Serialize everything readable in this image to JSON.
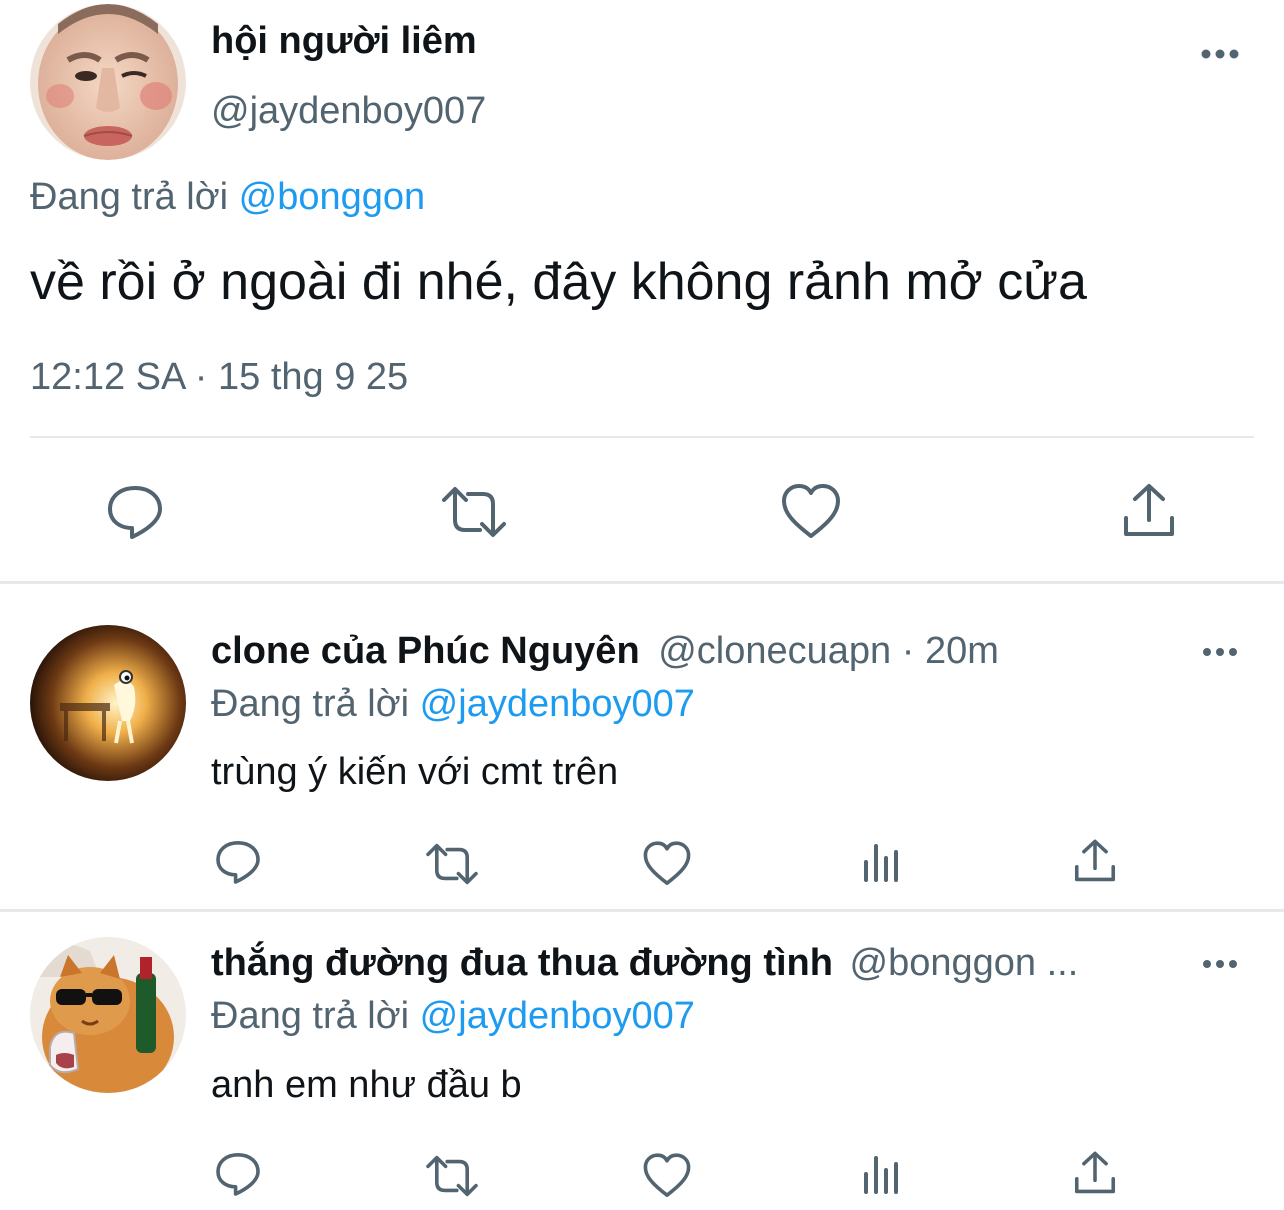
{
  "main_tweet": {
    "display_name": "hội người liêm",
    "handle": "@jaydenboy007",
    "replying_prefix": "Đang trả lời",
    "replying_to": "@bonggon",
    "text": "về rồi ở ngoài đi nhé, đây không rảnh mở cửa",
    "timestamp": "12:12 SA · 15 thg 9 25",
    "actions": [
      "reply-icon",
      "retweet-icon",
      "like-icon",
      "share-icon"
    ]
  },
  "replies": [
    {
      "display_name": "clone của Phúc Nguyên",
      "handle": "@clonecuapn",
      "time": "· 20m",
      "replying_prefix": "Đang trả lời",
      "replying_to": "@jaydenboy007",
      "text": "trùng ý kiến với cmt trên",
      "actions": [
        "reply-icon",
        "retweet-icon",
        "like-icon",
        "views-icon",
        "share-icon"
      ]
    },
    {
      "display_name": "thắng đường đua thua đường tình",
      "handle": "@bonggon ...",
      "replying_prefix": "Đang trả lời",
      "replying_to": "@jaydenboy007",
      "text": "anh em như đầu b",
      "actions": [
        "reply-icon",
        "retweet-icon",
        "like-icon",
        "views-icon",
        "share-icon"
      ]
    }
  ],
  "colors": {
    "text": "#0f1419",
    "muted": "#536471",
    "link": "#1d9bf0",
    "divider": "#e6e9eb"
  }
}
